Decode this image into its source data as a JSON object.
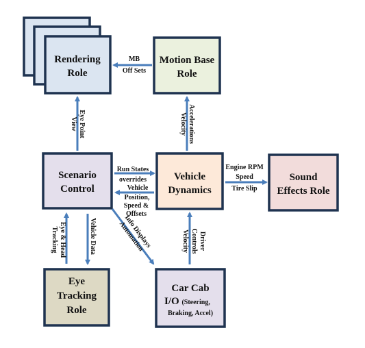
{
  "colors": {
    "border": "#1f3350",
    "arrow": "#4a7ebb",
    "rendering": "#dbe5f1",
    "motion_base": "#ebf1de",
    "scenario": "#e4dfec",
    "vehicle_dynamics": "#fde9d9",
    "sound": "#f2dcdb",
    "eye_tracking": "#ddd9c4",
    "car_cab": "#e4dfec"
  },
  "nodes": {
    "rendering": [
      "Rendering",
      "Role"
    ],
    "motion_base": [
      "Motion Base",
      "Role"
    ],
    "scenario": [
      "Scenario",
      "Control"
    ],
    "vehicle_dynamics": [
      "Vehicle",
      "Dynamics"
    ],
    "sound": [
      "Sound",
      "Effects Role"
    ],
    "eye_tracking": [
      "Eye",
      "Tracking",
      "Role"
    ],
    "car_cab": [
      "Car Cab",
      "I/O",
      "(Steering,",
      "Braking, Accel)"
    ]
  },
  "edges": {
    "mb_offsets": [
      "MB",
      "Off Sets"
    ],
    "eye_point": [
      "Eye Point",
      "View"
    ],
    "accel": [
      "Accelerations",
      "Velocity"
    ],
    "run_states": [
      "Run States",
      "overrides"
    ],
    "vehicle_pos": [
      "Vehicle",
      "Position,",
      "Speed &",
      "Offsets"
    ],
    "engine": [
      "Engine RPM",
      "Speed",
      "Tire Slip"
    ],
    "eye_head": [
      "Eye & Head",
      "Tracking"
    ],
    "vehicle_data": [
      "Vehicle Data"
    ],
    "info": [
      "Info Displays",
      "Automation"
    ],
    "driver": [
      "Driver",
      "Controls",
      "Velocity"
    ]
  }
}
